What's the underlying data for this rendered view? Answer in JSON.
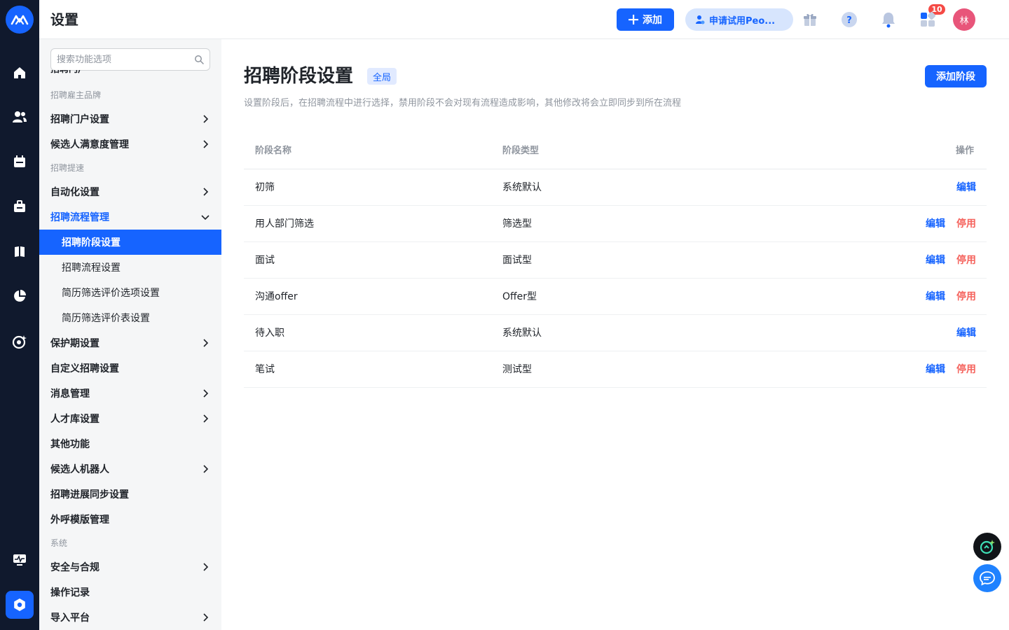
{
  "app": {
    "title": "设置"
  },
  "header": {
    "add_label": "添加",
    "trial_label": "申请试用Peo...",
    "notification_count": "10",
    "avatar_text": "林"
  },
  "rail": {
    "icons": [
      "home-icon",
      "people-icon",
      "calendar-icon",
      "briefcase-icon",
      "report-icon",
      "pie-chart-icon",
      "ai-target-icon",
      "monitor-icon",
      "settings-icon"
    ]
  },
  "sidebar": {
    "search_placeholder": "搜索功能选项",
    "groups": {
      "employer_brand": "招聘雇主品牌",
      "speedup": "招聘提速",
      "system": "系统"
    },
    "items": {
      "portal": "招聘门户设置",
      "satisfaction": "候选人满意度管理",
      "automation": "自动化设置",
      "process_mgmt": "招聘流程管理",
      "protection": "保护期设置",
      "custom": "自定义招聘设置",
      "message": "消息管理",
      "talent_pool": "人才库设置",
      "other": "其他功能",
      "robot": "候选人机器人",
      "progress_sync": "招聘进展同步设置",
      "call_template": "外呼模版管理",
      "security": "安全与合规",
      "log": "操作记录",
      "import": "导入平台"
    },
    "sub_items": {
      "stage_settings": "招聘阶段设置",
      "process_settings": "招聘流程设置",
      "resume_options": "简历筛选评价选项设置",
      "resume_forms": "简历筛选评价表设置"
    }
  },
  "main": {
    "title": "招聘阶段设置",
    "scope_tag": "全局",
    "add_stage_label": "添加阶段",
    "description": "设置阶段后，在招聘流程中进行选择，禁用阶段不会对现有流程造成影响，其他修改将会立即同步到所在流程",
    "table": {
      "headers": {
        "name": "阶段名称",
        "type": "阶段类型",
        "actions": "操作"
      },
      "edit_label": "编辑",
      "disable_label": "停用",
      "rows": [
        {
          "name": "初筛",
          "type": "系统默认"
        },
        {
          "name": "用人部门筛选",
          "type": "筛选型"
        },
        {
          "name": "面试",
          "type": "面试型"
        },
        {
          "name": "沟通offer",
          "type": "Offer型"
        },
        {
          "name": "待入职",
          "type": "系统默认"
        },
        {
          "name": "笔试",
          "type": "测试型"
        }
      ]
    }
  },
  "colors": {
    "accent": "#1664ff",
    "rail_bg": "#10192d",
    "danger": "#f5645e"
  }
}
